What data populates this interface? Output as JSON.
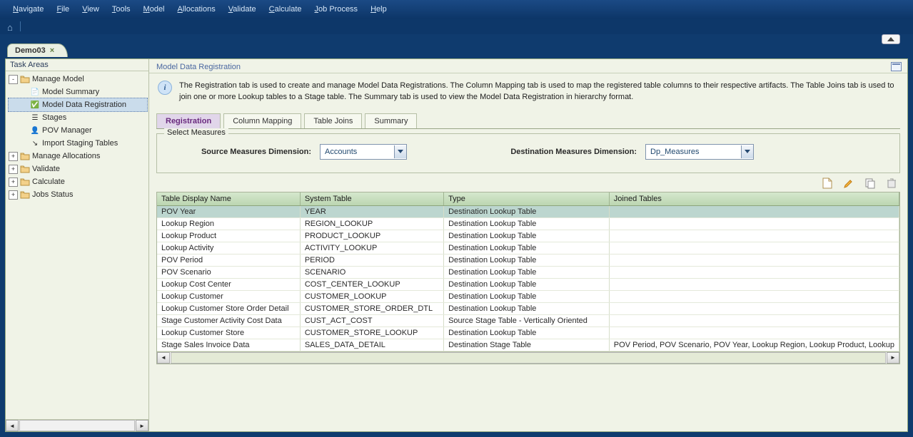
{
  "menu": [
    "Navigate",
    "File",
    "View",
    "Tools",
    "Model",
    "Allocations",
    "Validate",
    "Calculate",
    "Job Process",
    "Help"
  ],
  "workspace_tab": {
    "label": "Demo03"
  },
  "sidebar": {
    "title": "Task Areas",
    "tree": [
      {
        "kind": "folder",
        "label": "Manage Model",
        "expander": "-",
        "depth": 0
      },
      {
        "kind": "leaf",
        "label": "Model Summary",
        "icon": "doc",
        "depth": 1
      },
      {
        "kind": "leaf",
        "label": "Model Data Registration",
        "icon": "check",
        "depth": 1,
        "selected": true
      },
      {
        "kind": "leaf",
        "label": "Stages",
        "icon": "layers",
        "depth": 1
      },
      {
        "kind": "leaf",
        "label": "POV Manager",
        "icon": "person",
        "depth": 1
      },
      {
        "kind": "leaf",
        "label": "Import Staging Tables",
        "icon": "import",
        "depth": 1
      },
      {
        "kind": "folder",
        "label": "Manage Allocations",
        "expander": "+",
        "depth": 0
      },
      {
        "kind": "folder",
        "label": "Validate",
        "expander": "+",
        "depth": 0
      },
      {
        "kind": "folder",
        "label": "Calculate",
        "expander": "+",
        "depth": 0
      },
      {
        "kind": "folder",
        "label": "Jobs Status",
        "expander": "+",
        "depth": 0
      }
    ]
  },
  "panel": {
    "title": "Model Data Registration",
    "info_text": "The Registration tab is used to create and manage Model Data Registrations.  The Column Mapping tab is used to map the registered table columns to their respective artifacts.  The Table Joins tab is used to join one or more Lookup tables to a Stage table.  The Summary tab is used to view the Model Data Registration in hierarchy format."
  },
  "subtabs": [
    {
      "label": "Registration",
      "active": true
    },
    {
      "label": "Column Mapping",
      "active": false
    },
    {
      "label": "Table Joins",
      "active": false
    },
    {
      "label": "Summary",
      "active": false
    }
  ],
  "measures": {
    "group_label": "Select Measures",
    "source_label": "Source Measures Dimension:",
    "source_value": "Accounts",
    "dest_label": "Destination Measures Dimension:",
    "dest_value": "Dp_Measures"
  },
  "toolbar_icons": [
    "new-icon",
    "edit-icon",
    "copy-icon",
    "delete-icon"
  ],
  "grid": {
    "columns": [
      "Table Display Name",
      "System Table",
      "Type",
      "Joined Tables"
    ],
    "rows": [
      {
        "c": [
          "POV Year",
          "YEAR",
          "Destination Lookup Table",
          ""
        ],
        "selected": true
      },
      {
        "c": [
          "Lookup Region",
          "REGION_LOOKUP",
          "Destination Lookup Table",
          ""
        ]
      },
      {
        "c": [
          "Lookup Product",
          "PRODUCT_LOOKUP",
          "Destination Lookup Table",
          ""
        ]
      },
      {
        "c": [
          "Lookup Activity",
          "ACTIVITY_LOOKUP",
          "Destination Lookup Table",
          ""
        ]
      },
      {
        "c": [
          "POV Period",
          "PERIOD",
          "Destination Lookup Table",
          ""
        ]
      },
      {
        "c": [
          "POV Scenario",
          "SCENARIO",
          "Destination Lookup Table",
          ""
        ]
      },
      {
        "c": [
          "Lookup Cost Center",
          "COST_CENTER_LOOKUP",
          "Destination Lookup Table",
          ""
        ]
      },
      {
        "c": [
          "Lookup Customer",
          "CUSTOMER_LOOKUP",
          "Destination Lookup Table",
          ""
        ]
      },
      {
        "c": [
          "Lookup Customer Store Order Detail",
          "CUSTOMER_STORE_ORDER_DTL",
          "Destination Lookup Table",
          ""
        ]
      },
      {
        "c": [
          "Stage Customer Activity Cost Data",
          "CUST_ACT_COST",
          "Source Stage Table - Vertically Oriented",
          ""
        ]
      },
      {
        "c": [
          "Lookup Customer Store",
          "CUSTOMER_STORE_LOOKUP",
          "Destination Lookup Table",
          ""
        ]
      },
      {
        "c": [
          "Stage Sales Invoice Data",
          "SALES_DATA_DETAIL",
          "Destination Stage Table",
          "POV Period, POV Scenario, POV Year, Lookup Region, Lookup Product, Lookup"
        ]
      }
    ]
  }
}
